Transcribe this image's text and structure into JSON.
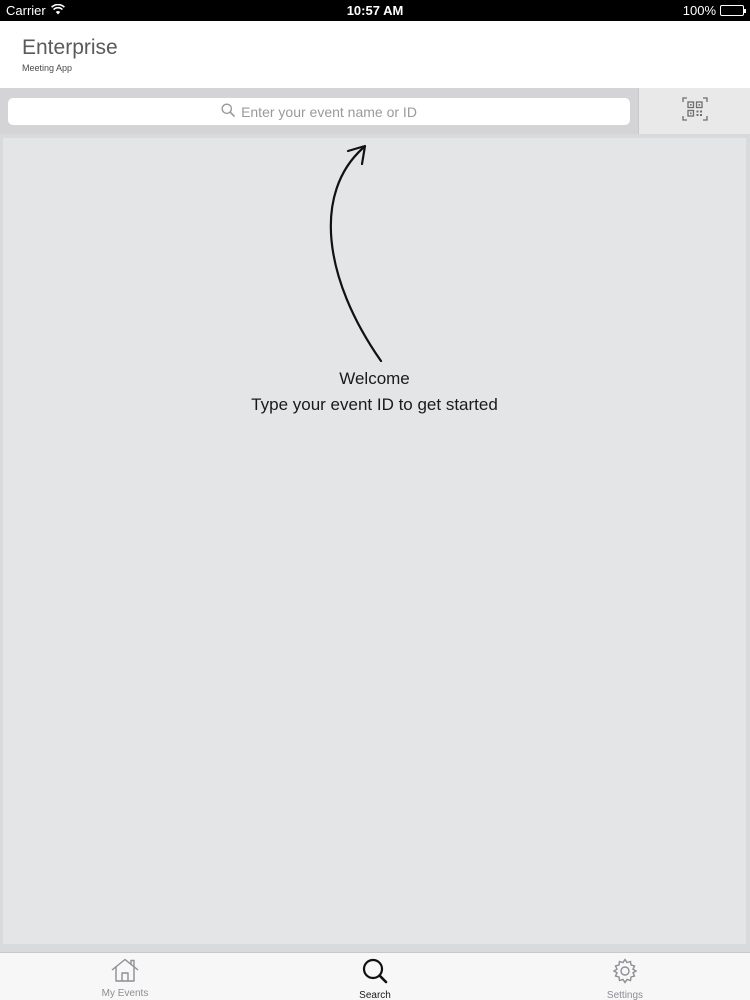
{
  "status_bar": {
    "carrier": "Carrier",
    "time": "10:57 AM",
    "battery": "100%"
  },
  "header": {
    "title": "Enterprise",
    "subtitle": "Meeting App"
  },
  "search": {
    "placeholder": "Enter your event name or ID",
    "value": ""
  },
  "qr_button": {
    "icon": "qr-code-icon"
  },
  "content": {
    "welcome": "Welcome",
    "instruction": "Type your event ID to get started"
  },
  "tabs": [
    {
      "label": "My Events",
      "icon": "home-icon",
      "active": false
    },
    {
      "label": "Search",
      "icon": "search-icon",
      "active": true
    },
    {
      "label": "Settings",
      "icon": "gear-icon",
      "active": false
    }
  ],
  "colors": {
    "active_tab": "#1a1a1a",
    "inactive_tab": "#8e8e93",
    "content_bg": "#e3e5e6"
  }
}
